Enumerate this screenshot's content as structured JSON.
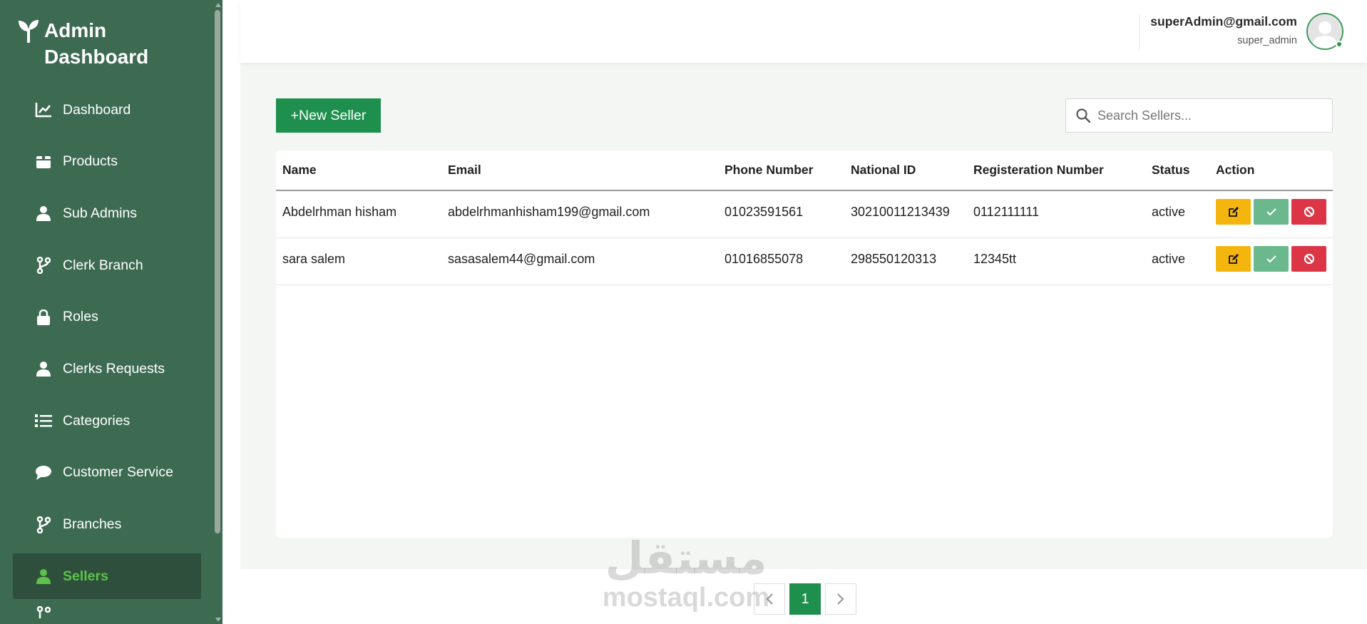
{
  "sidebar": {
    "brand": "Admin\nDashboard",
    "items": [
      {
        "label": "Dashboard",
        "icon": "chart-line-icon"
      },
      {
        "label": "Products",
        "icon": "box-icon"
      },
      {
        "label": "Sub Admins",
        "icon": "user-icon"
      },
      {
        "label": "Clerk Branch",
        "icon": "branch-icon"
      },
      {
        "label": "Roles",
        "icon": "lock-icon"
      },
      {
        "label": "Clerks Requests",
        "icon": "user-icon"
      },
      {
        "label": "Categories",
        "icon": "list-icon"
      },
      {
        "label": "Customer Service",
        "icon": "chat-icon"
      },
      {
        "label": "Branches",
        "icon": "branch-icon"
      },
      {
        "label": "Sellers",
        "icon": "user-icon",
        "active": true
      }
    ]
  },
  "header": {
    "email": "superAdmin@gmail.com",
    "role": "super_admin"
  },
  "toolbar": {
    "new_label": "+New Seller",
    "search_placeholder": "Search Sellers..."
  },
  "table": {
    "columns": [
      "Name",
      "Email",
      "Phone Number",
      "National ID",
      "Registeration Number",
      "Status",
      "Action"
    ],
    "rows": [
      {
        "name": "Abdelrhman hisham",
        "email": "abdelrhmanhisham199@gmail.com",
        "phone": "01023591561",
        "national_id": "30210011213439",
        "reg": "0112111111",
        "status": "active"
      },
      {
        "name": "sara salem",
        "email": "sasasalem44@gmail.com",
        "phone": "01016855078",
        "national_id": "298550120313",
        "reg": "12345tt",
        "status": "active"
      }
    ]
  },
  "pagination": {
    "current": "1"
  },
  "watermark": {
    "arabic": "مستقل",
    "latin": "mostaql.com"
  },
  "colors": {
    "sidebar": "#3d6b52",
    "accent": "#1f8f4e",
    "edit": "#f5b50f",
    "approve": "#6bb88e",
    "block": "#dc3545"
  }
}
